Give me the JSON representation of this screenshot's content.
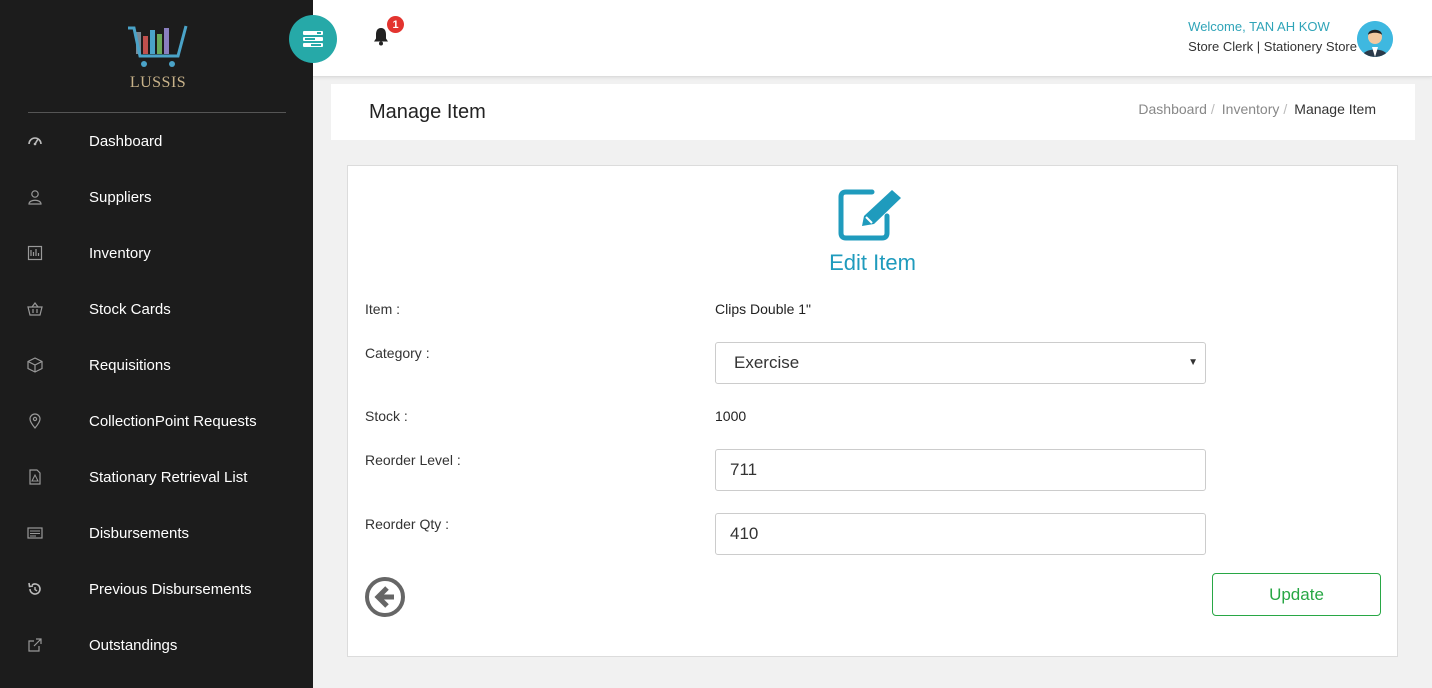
{
  "app": {
    "logo_text": "LUSSIS"
  },
  "sidebar": {
    "items": [
      {
        "label": "Dashboard",
        "icon": "dashboard-icon"
      },
      {
        "label": "Suppliers",
        "icon": "user-icon"
      },
      {
        "label": "Inventory",
        "icon": "inventory-icon"
      },
      {
        "label": "Stock Cards",
        "icon": "basket-icon"
      },
      {
        "label": "Requisitions",
        "icon": "box-icon"
      },
      {
        "label": "CollectionPoint Requests",
        "icon": "location-pin-icon"
      },
      {
        "label": "Stationary Retrieval List",
        "icon": "pdf-file-icon"
      },
      {
        "label": "Disbursements",
        "icon": "card-icon"
      },
      {
        "label": "Previous Disbursements",
        "icon": "history-icon"
      },
      {
        "label": "Outstandings",
        "icon": "external-link-icon"
      }
    ]
  },
  "topbar": {
    "notification_count": "1",
    "welcome": "Welcome, TAN AH KOW",
    "role": "Store Clerk | Stationery Store"
  },
  "page": {
    "title": "Manage Item",
    "breadcrumb": [
      "Dashboard",
      "Inventory",
      "Manage Item"
    ]
  },
  "form": {
    "heading": "Edit Item",
    "item_label": "Item :",
    "item_value": "Clips Double 1\"",
    "category_label": "Category :",
    "category_value": "Exercise",
    "stock_label": "Stock :",
    "stock_value": "1000",
    "reorder_level_label": "Reorder Level :",
    "reorder_level_value": "711",
    "reorder_qty_label": "Reorder Qty :",
    "reorder_qty_value": "410",
    "update_label": "Update"
  },
  "colors": {
    "sidebar_bg": "#1c1c1c",
    "accent_teal": "#26a9a8",
    "heading_blue": "#1f9bbd",
    "success_green": "#28a745",
    "badge_red": "#e3342f"
  }
}
